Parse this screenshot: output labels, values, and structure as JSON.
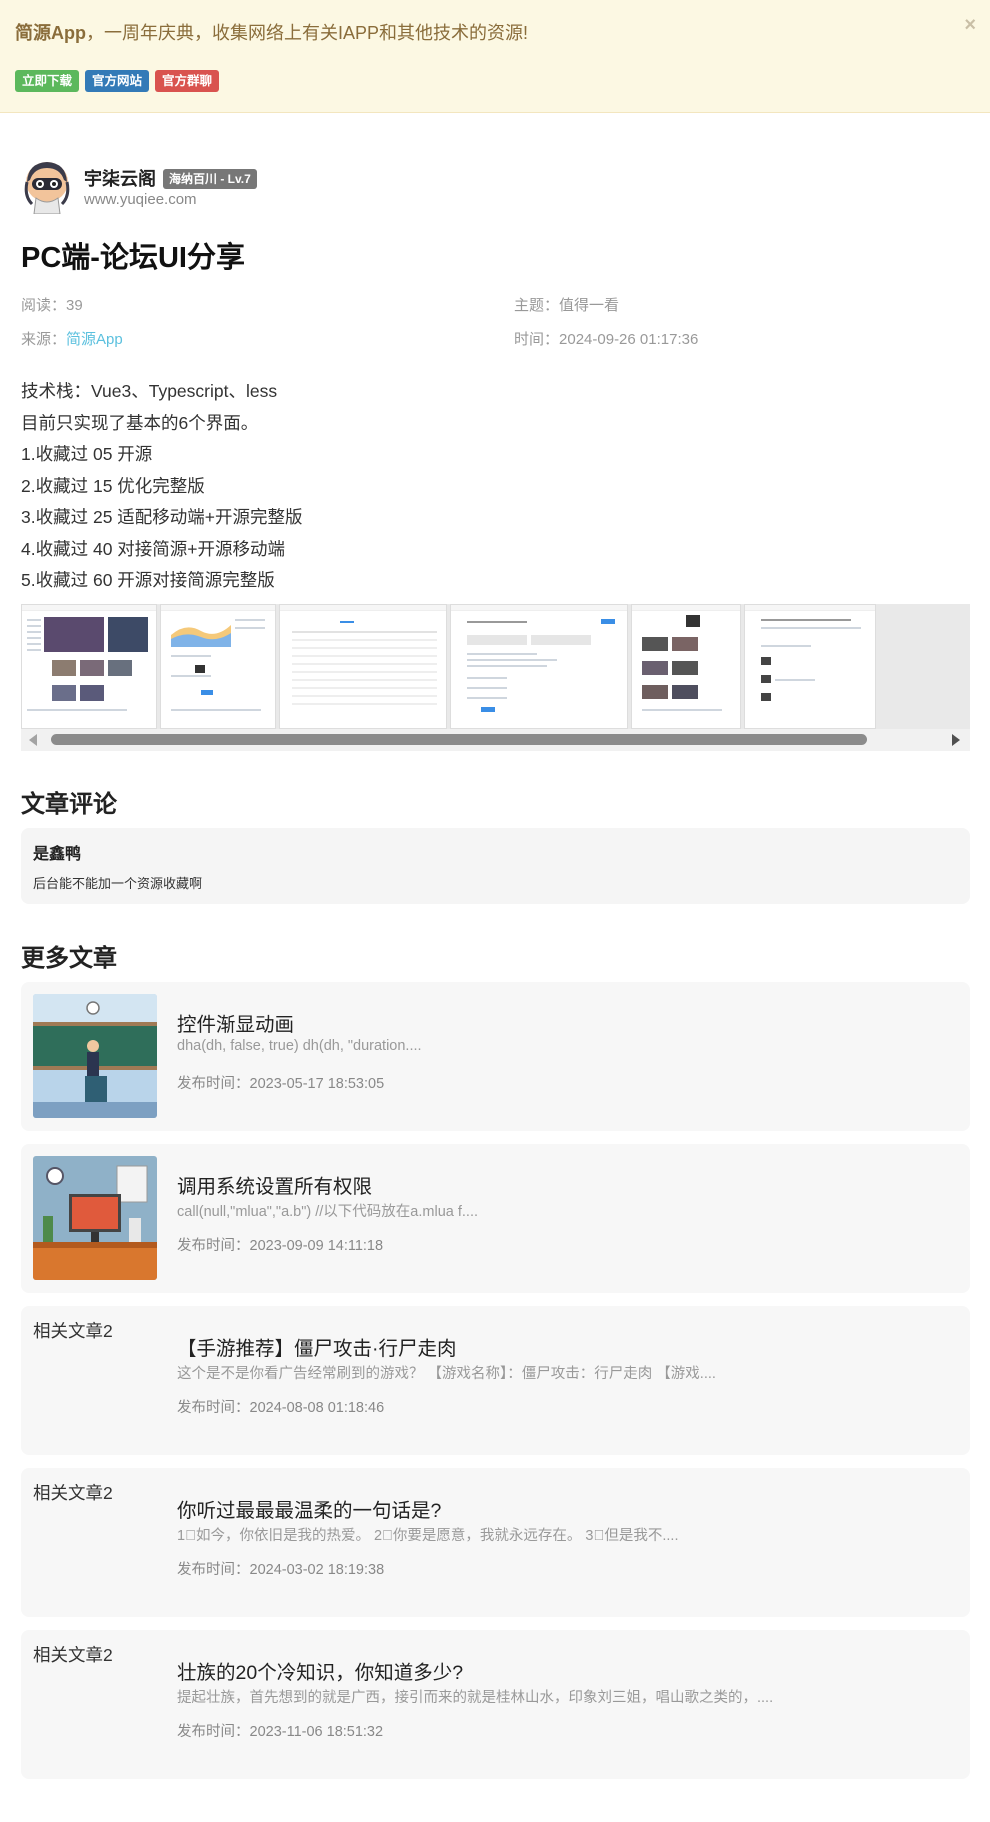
{
  "banner": {
    "brand": "简源App",
    "message": "，一周年庆典，收集网络上有关IAPP和其他技术的资源!",
    "close": "×",
    "buttons": [
      {
        "label": "立即下载",
        "color": "#5cb85c"
      },
      {
        "label": "官方网站",
        "color": "#337ab7"
      },
      {
        "label": "官方群聊",
        "color": "#d9534f"
      }
    ]
  },
  "author": {
    "name": "宇柒云阁",
    "level": "海纳百川 - Lv.7",
    "site": "www.yuqiee.com"
  },
  "article": {
    "title": "PC端-论坛UI分享",
    "meta": {
      "reads_label": "阅读：",
      "reads": "39",
      "topic_label": "主题：",
      "topic": "值得一看",
      "source_label": "来源：",
      "source": "简源App",
      "time_label": "时间：",
      "time": "2024-09-26 01:17:36"
    },
    "content": [
      "技术栈：Vue3、Typescript、less",
      "目前只实现了基本的6个界面。",
      "1.收藏过 05 开源",
      "2.收藏过 15 优化完整版",
      "3.收藏过 25 适配移动端+开源完整版",
      "4.收藏过 40 对接简源+开源移动端",
      "5.收藏过 60 开源对接简源完整版"
    ]
  },
  "comments_section": {
    "title": "文章评论",
    "items": [
      {
        "user": "是鑫鸭",
        "text": "后台能不能加一个资源收藏啊"
      }
    ]
  },
  "more_section": {
    "title": "更多文章",
    "date_label": "发布时间：",
    "items": [
      {
        "title": "控件渐显动画",
        "desc": "dha(dh, false, true) dh(dh, \"duration....",
        "date": "2023-05-17 18:53:05",
        "image": "classroom-illustration"
      },
      {
        "title": "调用系统设置所有权限",
        "desc": "call(null,\"mlua\",\"a.b\") //以下代码放在a.mlua f....",
        "date": "2023-09-09 14:11:18",
        "image": "office-desk-illustration"
      },
      {
        "title": "【手游推荐】僵尸攻击·行尸走肉",
        "desc": "这个是不是你看广告经常刷到的游戏？ 【游戏名称】：僵尸攻击：行尸走肉 【游戏....",
        "date": "2024-08-08 01:18:46",
        "image_alt": "相关文章2"
      },
      {
        "title": "你听过最最最温柔的一句话是?",
        "desc": "1⃣如今，你依旧是我的热爱。 2⃣你要是愿意，我就永远存在。 3⃣但是我不....",
        "date": "2024-03-02 18:19:38",
        "image_alt": "相关文章2"
      },
      {
        "title": "壮族的20个冷知识，你知道多少?",
        "desc": "提起壮族，首先想到的就是广西，接引而来的就是桂林山水，印象刘三姐，唱山歌之类的，....",
        "date": "2023-11-06 18:51:32",
        "image_alt": "相关文章2"
      }
    ]
  }
}
